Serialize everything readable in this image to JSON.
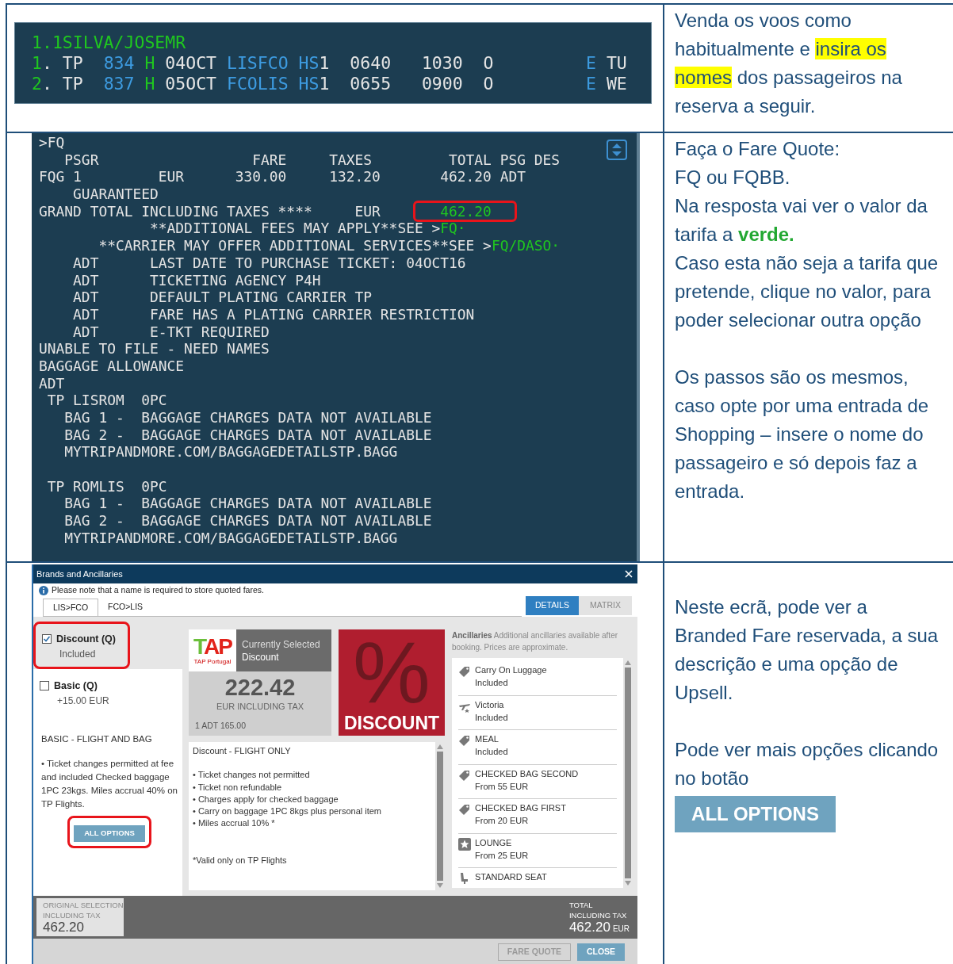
{
  "rows": [
    {
      "terminal": {
        "lines": [
          {
            "segments": [
              {
                "text": "1.1SILVA/JOSEMR",
                "kind": "prompt"
              }
            ]
          },
          {
            "segments": [
              {
                "text": "1",
                "kind": "prompt"
              },
              {
                "text": ". TP  ",
                "kind": "text"
              },
              {
                "text": "834 ",
                "kind": "code"
              },
              {
                "text": "H",
                "kind": "prompt"
              },
              {
                "text": " 04OCT ",
                "kind": "text"
              },
              {
                "text": "LISFCO HS",
                "kind": "code"
              },
              {
                "text": "1  0640   1030  O         ",
                "kind": "text"
              },
              {
                "text": "E",
                "kind": "code"
              },
              {
                "text": " TU",
                "kind": "text"
              }
            ]
          },
          {
            "segments": [
              {
                "text": "2",
                "kind": "prompt"
              },
              {
                "text": ". TP  ",
                "kind": "text"
              },
              {
                "text": "837 ",
                "kind": "code"
              },
              {
                "text": "H",
                "kind": "prompt"
              },
              {
                "text": " 05OCT ",
                "kind": "text"
              },
              {
                "text": "FCOLIS HS",
                "kind": "code"
              },
              {
                "text": "1  0655   0900  O         ",
                "kind": "text"
              },
              {
                "text": "E",
                "kind": "code"
              },
              {
                "text": " WE",
                "kind": "text"
              }
            ]
          }
        ]
      },
      "blocks": [
        [
          {
            "segments": [
              {
                "text": "Venda os voos como habitualmente e ",
                "kind": "plain"
              },
              {
                "text": "insira os nomes",
                "kind": "marked"
              },
              {
                "text": " dos passageiros na reserva a seguir.",
                "kind": "plain"
              }
            ]
          }
        ]
      ]
    },
    {
      "terminal": {
        "lines": [
          {
            "kind": "text",
            "segments": [
              {
                "text": ">FQ",
                "kind": "text"
              }
            ]
          },
          {
            "kind": "text",
            "segments": [
              {
                "text": "   PSGR                  FARE     TAXES         TOTAL PSG DES",
                "kind": "text"
              }
            ]
          },
          {
            "kind": "text",
            "segments": [
              {
                "text": "FQG 1         EUR      330.00     132.20       462.20 ADT",
                "kind": "text"
              }
            ]
          },
          {
            "kind": "text",
            "segments": [
              {
                "text": "    GUARANTEED",
                "kind": "text"
              }
            ]
          },
          {
            "kind": "text",
            "segments": [
              {
                "text": "GRAND TOTAL INCLUDING TAXES ****     EUR       ",
                "kind": "text"
              },
              {
                "text": "462.20",
                "kind": "prompt",
                "highlighted": true
              }
            ]
          },
          {
            "kind": "text",
            "segments": [
              {
                "text": "             **ADDITIONAL FEES MAY APPLY**SEE >",
                "kind": "text"
              },
              {
                "text": "FQ·",
                "kind": "prompt"
              }
            ]
          },
          {
            "kind": "text",
            "segments": [
              {
                "text": "       **CARRIER MAY OFFER ADDITIONAL SERVICES**SEE >",
                "kind": "text"
              },
              {
                "text": "FQ/DASO·",
                "kind": "prompt"
              }
            ]
          },
          {
            "kind": "text",
            "segments": [
              {
                "text": "    ADT      LAST DATE TO PURCHASE TICKET: 04OCT16",
                "kind": "text"
              }
            ]
          },
          {
            "kind": "text",
            "segments": [
              {
                "text": "    ADT      TICKETING AGENCY P4H",
                "kind": "text"
              }
            ]
          },
          {
            "kind": "text",
            "segments": [
              {
                "text": "    ADT      DEFAULT PLATING CARRIER TP",
                "kind": "text"
              }
            ]
          },
          {
            "kind": "text",
            "segments": [
              {
                "text": "    ADT      FARE HAS A PLATING CARRIER RESTRICTION",
                "kind": "text"
              }
            ]
          },
          {
            "kind": "text",
            "segments": [
              {
                "text": "    ADT      E-TKT REQUIRED",
                "kind": "text"
              }
            ]
          },
          {
            "kind": "text",
            "segments": [
              {
                "text": "UNABLE TO FILE - NEED NAMES",
                "kind": "text"
              }
            ]
          },
          {
            "kind": "text",
            "segments": [
              {
                "text": "BAGGAGE ALLOWANCE",
                "kind": "text"
              }
            ]
          },
          {
            "kind": "text",
            "segments": [
              {
                "text": "ADT",
                "kind": "text"
              }
            ]
          },
          {
            "kind": "text",
            "segments": [
              {
                "text": " TP LISROM  0PC",
                "kind": "text"
              }
            ]
          },
          {
            "kind": "text",
            "segments": [
              {
                "text": "   BAG 1 -  BAGGAGE CHARGES DATA NOT AVAILABLE",
                "kind": "text"
              }
            ]
          },
          {
            "kind": "text",
            "segments": [
              {
                "text": "   BAG 2 -  BAGGAGE CHARGES DATA NOT AVAILABLE",
                "kind": "text"
              }
            ]
          },
          {
            "kind": "text",
            "segments": [
              {
                "text": "   MYTRIPANDMORE.COM/BAGGAGEDETAILSTP.BAGG",
                "kind": "text"
              }
            ]
          },
          {
            "kind": "blank"
          },
          {
            "kind": "text",
            "segments": [
              {
                "text": " TP ROMLIS  0PC",
                "kind": "text"
              }
            ]
          },
          {
            "kind": "text",
            "segments": [
              {
                "text": "   BAG 1 -  BAGGAGE CHARGES DATA NOT AVAILABLE",
                "kind": "text"
              }
            ]
          },
          {
            "kind": "text",
            "segments": [
              {
                "text": "   BAG 2 -  BAGGAGE CHARGES DATA NOT AVAILABLE",
                "kind": "text"
              }
            ]
          },
          {
            "kind": "text",
            "segments": [
              {
                "text": "   MYTRIPANDMORE.COM/BAGGAGEDETAILSTP.BAGG",
                "kind": "text"
              }
            ]
          }
        ]
      },
      "blocks": [
        [
          {
            "segments": [
              {
                "text": "Faça o Fare Quote:",
                "kind": "plain"
              }
            ]
          },
          {
            "segments": [
              {
                "text": "FQ ou FQBB.",
                "kind": "plain"
              }
            ]
          },
          {
            "segments": [
              {
                "text": "Na resposta vai ver o valor da tarifa a ",
                "kind": "plain"
              },
              {
                "text": "verde.",
                "kind": "emphasis"
              }
            ]
          },
          {
            "segments": [
              {
                "text": "Caso esta não seja a tarifa que pretende, clique no valor, para poder selecionar outra opção",
                "kind": "plain"
              }
            ]
          }
        ],
        [
          {
            "segments": [
              {
                "text": "Os passos são os mesmos, caso opte por uma entrada de Shopping – insere o nome do passageiro e só depois faz a entrada.",
                "kind": "plain"
              }
            ]
          }
        ]
      ]
    },
    {
      "dialog": {
        "title": "Brands and Ancillaries",
        "notice": "Please note that a name is required to store quoted fares.",
        "segments": [
          {
            "label": "LIS>FCO",
            "selected": true
          },
          {
            "label": "FCO>LIS",
            "selected": false
          }
        ],
        "views": [
          {
            "label": "DETAILS",
            "selected": true
          },
          {
            "label": "MATRIX",
            "selected": false
          }
        ],
        "fares": [
          {
            "name": "Discount (Q)",
            "price": "Included",
            "checked": true,
            "highlighted": true
          },
          {
            "name": "Basic (Q)",
            "price": "+15.00  EUR",
            "checked": false,
            "highlighted": false
          }
        ],
        "upsell": {
          "title": "BASIC - FLIGHT AND BAG",
          "description": "• Ticket changes permitted at fee and included Checked baggage 1PC 23kgs. Miles accrual 40% on TP Flights.",
          "button": {
            "label": "ALL OPTIONS",
            "highlighted": true
          }
        },
        "selected_card": {
          "logo": "TAP",
          "logo_caption": "TAP Portugal",
          "status": "Currently Selected",
          "brand": "Discount",
          "price": "222.42",
          "price_note": "EUR INCLUDING TAX",
          "pax": "1 ADT 165.00"
        },
        "brand_image": {
          "symbol": "%",
          "caption": "DISCOUNT"
        },
        "fare_details": {
          "title": "Discount - FLIGHT ONLY",
          "bullets": [
            "• Ticket changes not permitted",
            "• Ticket non refundable",
            "• Charges apply for checked baggage",
            "• Carry on baggage 1PC 8kgs plus personal item",
            "• Miles accrual 10% *"
          ],
          "footnote": "*Valid only on TP Flights"
        },
        "ancillaries": {
          "heading": "Ancillaries",
          "note": "Additional ancillaries available after booking. Prices are approximate.",
          "items": [
            {
              "kind": "tag",
              "name": "Carry On Luggage",
              "price": "Included"
            },
            {
              "kind": "plane",
              "name": "Victoria",
              "price": "Included"
            },
            {
              "kind": "tag",
              "name": "MEAL",
              "price": "Included"
            },
            {
              "kind": "tag",
              "name": "CHECKED BAG SECOND",
              "price": "From 55 EUR"
            },
            {
              "kind": "tag",
              "name": "CHECKED BAG FIRST",
              "price": "From 20 EUR"
            },
            {
              "kind": "star",
              "name": "LOUNGE",
              "price": "From 25 EUR"
            },
            {
              "kind": "seat",
              "name": "STANDARD SEAT"
            }
          ]
        },
        "footer": {
          "original_label": [
            "ORIGINAL SELECTION",
            "INCLUDING TAX"
          ],
          "original_value": "462.20",
          "total_label": [
            "TOTAL",
            "INCLUDING TAX"
          ],
          "total_value": "462.20",
          "currency": "EUR"
        },
        "buttons": [
          {
            "label": "FARE QUOTE",
            "disabled": true
          },
          {
            "label": "CLOSE",
            "disabled": false
          }
        ]
      },
      "blocks": [
        [
          {
            "segments": [
              {
                "text": "Neste ecrã, pode ver a Branded Fare reservada, a sua descrição e uma opção de Upsell.",
                "kind": "plain"
              }
            ]
          }
        ],
        [
          {
            "segments": [
              {
                "text": "Pode ver mais opções clicando no botão",
                "kind": "plain"
              }
            ]
          }
        ]
      ],
      "button": {
        "label": "ALL OPTIONS"
      }
    }
  ]
}
